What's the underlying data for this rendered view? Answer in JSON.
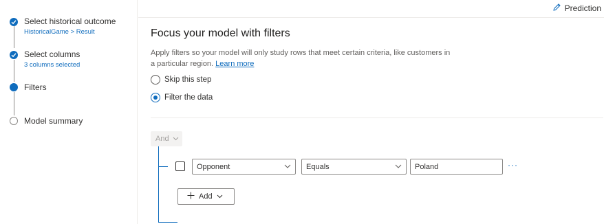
{
  "wizard": {
    "steps": [
      {
        "title": "Select historical outcome",
        "subtitle": "HistoricalGame > Result",
        "status": "complete"
      },
      {
        "title": "Select columns",
        "subtitle": "3 columns selected",
        "status": "complete"
      },
      {
        "title": "Filters",
        "subtitle": "",
        "status": "current"
      },
      {
        "title": "Model summary",
        "subtitle": "",
        "status": "pending"
      }
    ]
  },
  "header": {
    "prediction_label": "Prediction",
    "icon": "pencil-icon"
  },
  "main": {
    "title": "Focus your model with filters",
    "description": "Apply filters so your model will only study rows that meet certain criteria, like customers in a particular region.",
    "learn_more": "Learn more",
    "options": [
      {
        "label": "Skip this step",
        "selected": false
      },
      {
        "label": "Filter the data",
        "selected": true
      }
    ],
    "filter": {
      "group_operator": "And",
      "rows": [
        {
          "checked": false,
          "column": "Opponent",
          "operator": "Equals",
          "value": "Poland"
        }
      ],
      "more_label": "···",
      "add_label": "Add"
    }
  },
  "colors": {
    "accent": "#0f6cbd",
    "border": "#8a8886",
    "text": "#323130"
  }
}
